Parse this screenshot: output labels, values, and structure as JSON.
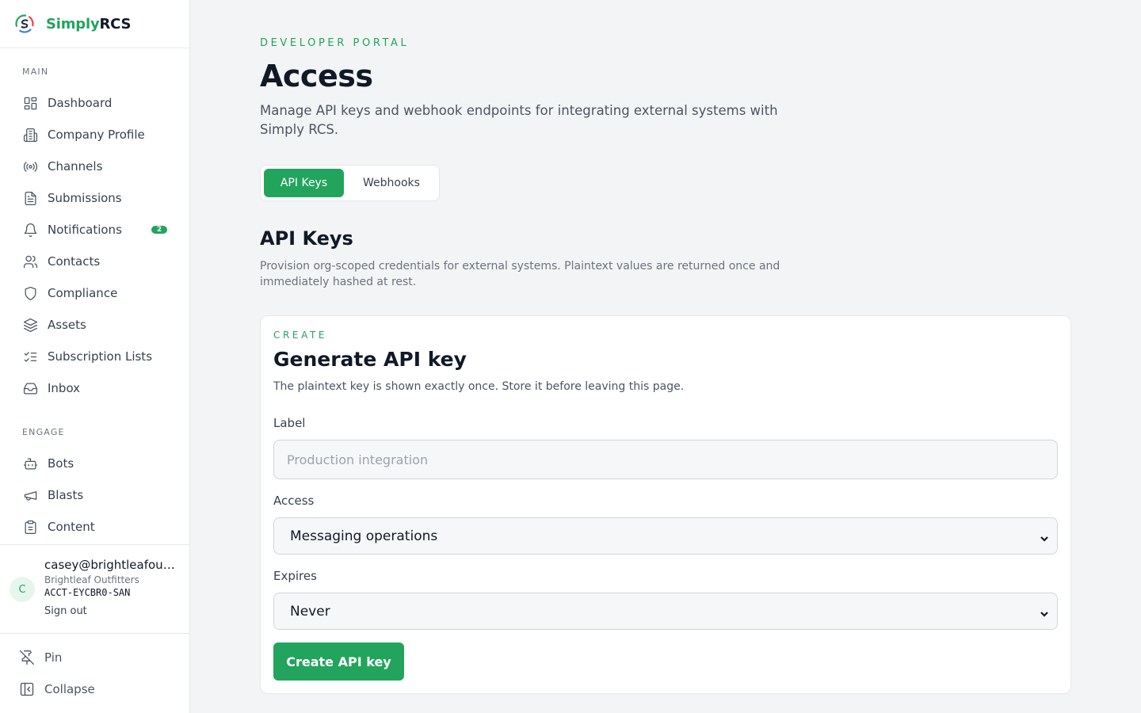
{
  "brand": {
    "name_accent": "Simply",
    "name_rest": "RCS"
  },
  "sidebar": {
    "main_heading": "MAIN",
    "main_items": [
      {
        "label": "Dashboard",
        "icon": "dashboard-icon"
      },
      {
        "label": "Company Profile",
        "icon": "building-icon"
      },
      {
        "label": "Channels",
        "icon": "broadcast-icon"
      },
      {
        "label": "Submissions",
        "icon": "document-icon"
      },
      {
        "label": "Notifications",
        "icon": "bell-icon",
        "badge": "2"
      },
      {
        "label": "Contacts",
        "icon": "users-icon"
      },
      {
        "label": "Compliance",
        "icon": "shield-icon"
      },
      {
        "label": "Assets",
        "icon": "layers-icon"
      },
      {
        "label": "Subscription Lists",
        "icon": "list-checks-icon"
      },
      {
        "label": "Inbox",
        "icon": "inbox-icon"
      }
    ],
    "engage_heading": "ENGAGE",
    "engage_items": [
      {
        "label": "Bots",
        "icon": "bot-icon"
      },
      {
        "label": "Blasts",
        "icon": "megaphone-icon"
      },
      {
        "label": "Content",
        "icon": "clipboard-icon"
      }
    ],
    "user": {
      "avatar_initial": "C",
      "email": "casey@brightleafoutfitters.com",
      "org": "Brightleaf Outfitters",
      "account_id": "ACCT-EYCBR0-SAN",
      "sign_out": "Sign out"
    },
    "pin_label": "Pin",
    "collapse_label": "Collapse"
  },
  "header": {
    "eyebrow": "DEVELOPER PORTAL",
    "title": "Access",
    "description": "Manage API keys and webhook endpoints for integrating external systems with Simply RCS."
  },
  "tabs": [
    {
      "label": "API Keys",
      "active": true
    },
    {
      "label": "Webhooks",
      "active": false
    }
  ],
  "section": {
    "title": "API Keys",
    "description": "Provision org-scoped credentials for external systems. Plaintext values are returned once and immediately hashed at rest."
  },
  "create_card": {
    "eyebrow": "CREATE",
    "title": "Generate API key",
    "description": "The plaintext key is shown exactly once. Store it before leaving this page.",
    "label_field": {
      "label": "Label",
      "value": "",
      "placeholder": "Production integration"
    },
    "access_field": {
      "label": "Access",
      "selected": "Messaging operations"
    },
    "expires_field": {
      "label": "Expires",
      "selected": "Never"
    },
    "submit_label": "Create API key"
  },
  "colors": {
    "accent": "#22a45d",
    "background": "#f3f4f5",
    "surface": "#ffffff"
  }
}
